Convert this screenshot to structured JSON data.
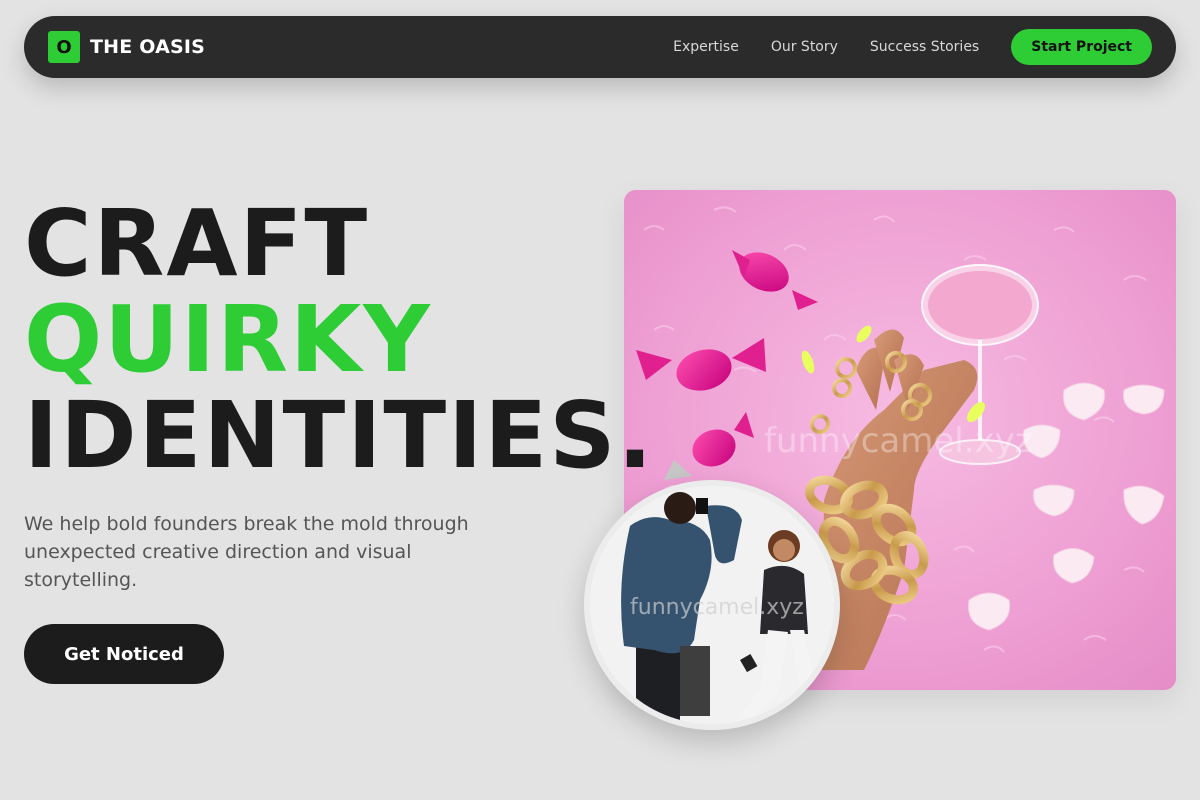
{
  "nav": {
    "logo_letter": "O",
    "brand": "THE OASIS",
    "links": [
      "Expertise",
      "Our Story",
      "Success Stories"
    ],
    "cta_label": "Start Project"
  },
  "hero": {
    "line1": "CRAFT",
    "line2": "QUIRKY",
    "line3": "IDENTITIES.",
    "subtext": "We help bold founders break the mold through unexpected creative direction and visual storytelling.",
    "cta_label": "Get Noticed"
  },
  "images": {
    "main_watermark": "funnycamel.xyz",
    "circle_watermark": "funnycamel.xyz"
  },
  "colors": {
    "accent": "#2ecc35",
    "nav_bg": "#2b2b2b",
    "page_bg": "#e3e3e3",
    "dark": "#1c1c1c"
  }
}
